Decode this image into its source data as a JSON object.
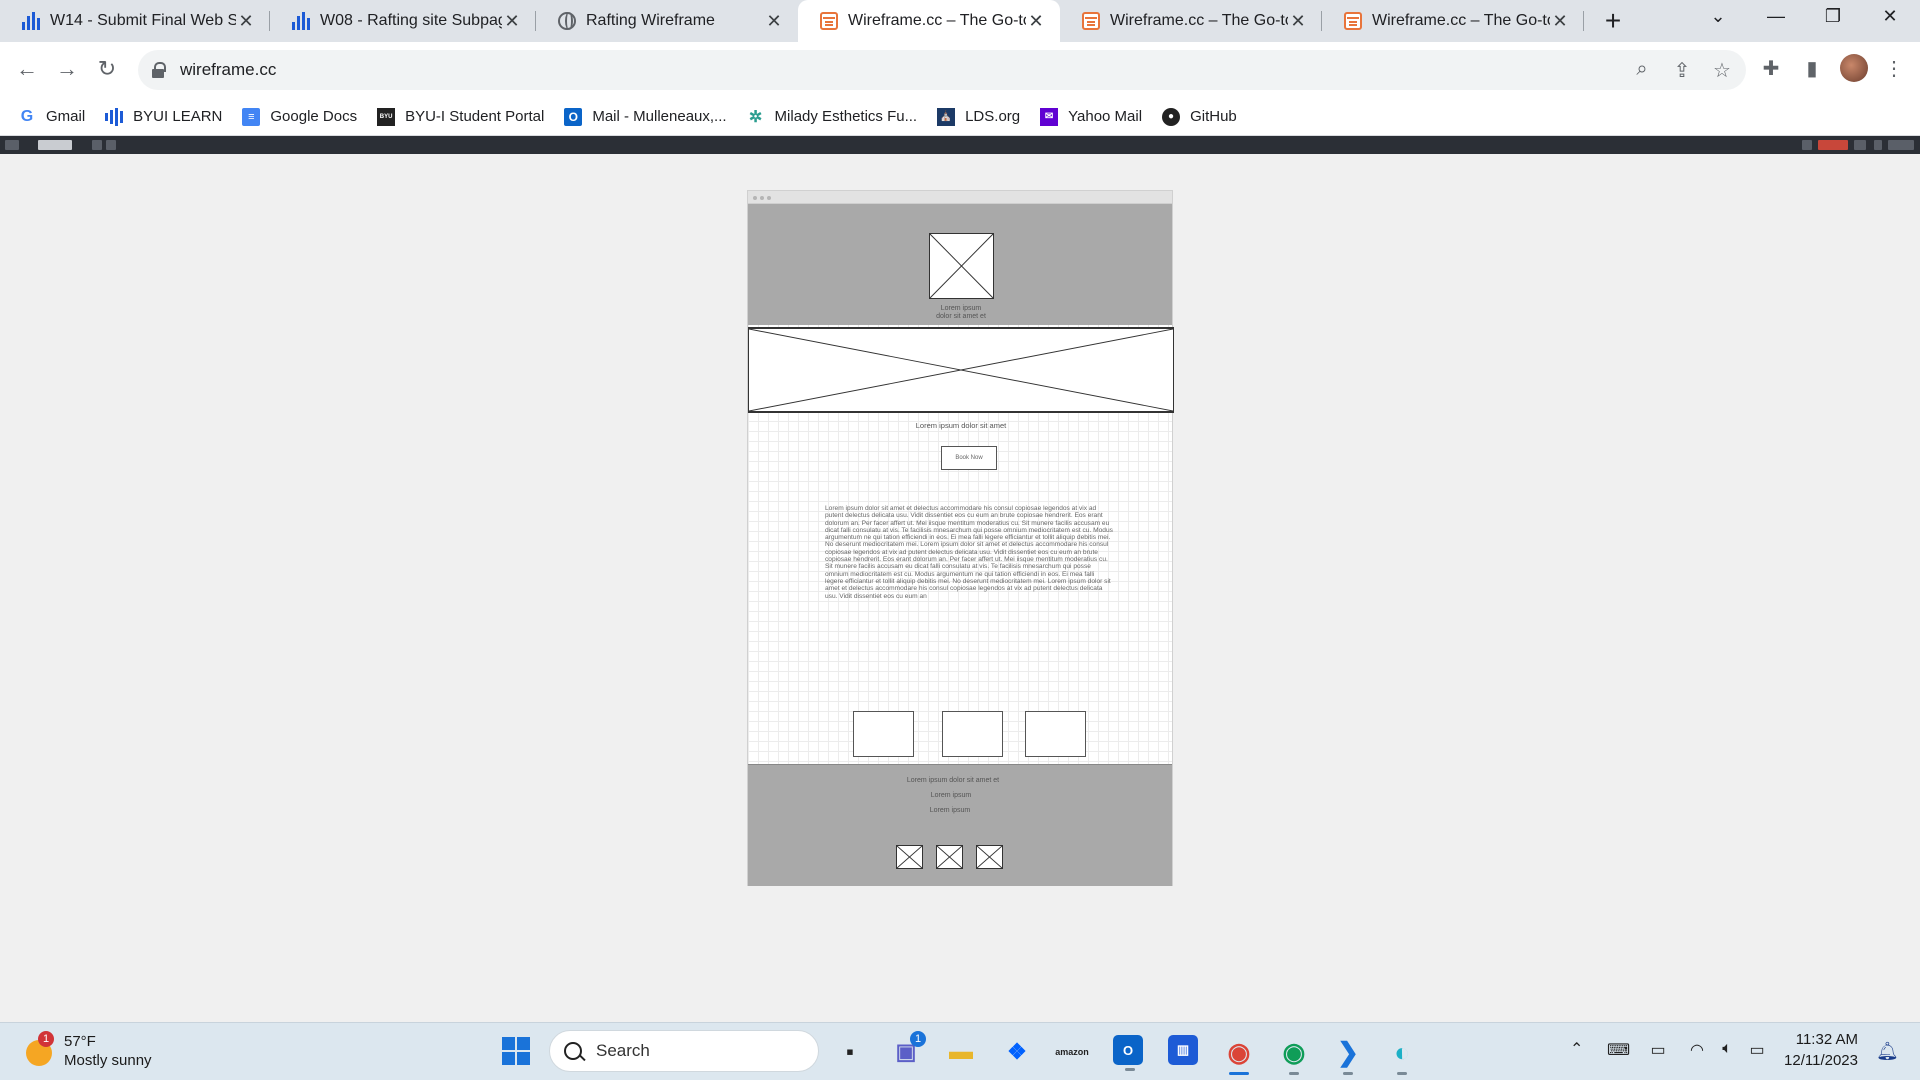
{
  "browser": {
    "tabs": [
      {
        "title": "W14 - Submit Final Web Si",
        "icon": "byui-bars-icon",
        "active": false
      },
      {
        "title": "W08 - Rafting site Subpag",
        "icon": "byui-bars-icon",
        "active": false
      },
      {
        "title": "Rafting Wireframe",
        "icon": "globe-icon",
        "active": false
      },
      {
        "title": "Wireframe.cc – The Go-to",
        "icon": "wireframe-cc-icon",
        "active": true
      },
      {
        "title": "Wireframe.cc – The Go-to",
        "icon": "wireframe-cc-icon",
        "active": false
      },
      {
        "title": "Wireframe.cc – The Go-to",
        "icon": "wireframe-cc-icon",
        "active": false
      }
    ],
    "url": "wireframe.cc",
    "bookmarks": [
      {
        "label": "Gmail",
        "icon": "google-icon"
      },
      {
        "label": "BYUI LEARN",
        "icon": "byui-bars-icon"
      },
      {
        "label": "Google Docs",
        "icon": "docs-icon"
      },
      {
        "label": "BYU-I Student Portal",
        "icon": "byu-idaho-icon"
      },
      {
        "label": "Mail - Mulleneaux,...",
        "icon": "outlook-icon"
      },
      {
        "label": "Milady Esthetics Fu...",
        "icon": "milady-icon"
      },
      {
        "label": "LDS.org",
        "icon": "lds-icon"
      },
      {
        "label": "Yahoo Mail",
        "icon": "yahoo-mail-icon"
      },
      {
        "label": "GitHub",
        "icon": "github-icon"
      }
    ]
  },
  "wireframe": {
    "header_caption_line1": "Lorem ipsum",
    "header_caption_line2": "dolor sit amet et",
    "tagline": "Lorem ipsum dolor sit amet",
    "cta_label": "Book Now",
    "body_text": "Lorem ipsum dolor sit amet et delectus accommodare his consul copiosae legendos at vix ad putent delectus delicata usu. Vidit dissentiet eos cu eum an brute copiosae hendrerit. Eos erant dolorum an. Per facer affert ut. Mei iisque mentitum moderatius cu. Sit munere facilis accusam eu dicat falli consulatu at vis. Te facilisis mnesarchum qui posse omnium mediocritatem est cu. Modus argumentum ne qui tation efficiendi in eos. Ei mea falli legere efficiantur et tollit aliquip debitis mei. No deserunt mediocritatem mei. Lorem ipsum dolor sit amet et delectus accommodare his consul copiosae legendos at vix ad putent delectus delicata usu. Vidit dissentiet eos cu eum an brute copiosae hendrerit. Eos erant dolorum an. Per facer affert ut. Mei iisque mentitum moderatius cu. Sit munere facilis accusam eu dicat falli consulatu at vis. Te facilisis mnesarchum qui posse omnium mediocritatem est cu. Modus argumentum ne qui tation efficiendi in eos. Ei mea falli legere efficiantur et tollit aliquip debitis mei. No deserunt mediocritatem mei. Lorem ipsum dolor sit amet et delectus accommodare his consul copiosae legendos at vix ad putent delectus delicata usu. Vidit dissentiet eos cu eum an",
    "footer_line1": "Lorem ipsum dolor sit amet et",
    "footer_line2": "Lorem ipsum",
    "footer_line3": "Lorem ipsum"
  },
  "taskbar": {
    "weather_badge": "1",
    "weather_temp": "57°F",
    "weather_desc": "Mostly sunny",
    "search_label": "Search",
    "chat_badge": "1",
    "clock_time": "11:32 AM",
    "clock_date": "12/11/2023"
  },
  "colors": {
    "accent": "#1a73d9",
    "wireframe_gray": "#a9a9a9",
    "app_toolbar": "#2b2f36"
  }
}
